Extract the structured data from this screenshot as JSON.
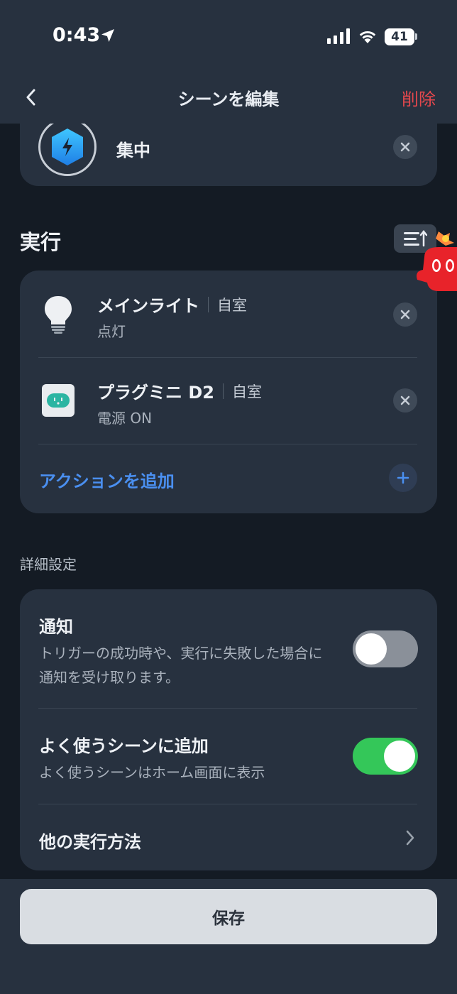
{
  "status": {
    "time": "0:43",
    "battery": "41"
  },
  "nav": {
    "title": "シーンを編集",
    "delete": "削除"
  },
  "scene": {
    "name": "集中"
  },
  "execution": {
    "title": "実行",
    "items": [
      {
        "name": "メインライト",
        "room": "自室",
        "state": "点灯"
      },
      {
        "name": "プラグミニ D2",
        "room": "自室",
        "state": "電源 ON"
      }
    ],
    "add_action": "アクションを追加"
  },
  "details": {
    "title": "詳細設定",
    "notify": {
      "title": "通知",
      "desc_line1": "トリガーの成功時や、実行に失敗した場合に",
      "desc_line2": "通知を受け取ります。",
      "enabled": false
    },
    "favorite": {
      "title": "よく使うシーンに追加",
      "desc": "よく使うシーンはホーム画面に表示",
      "enabled": true
    },
    "other": {
      "title": "他の実行方法"
    }
  },
  "save": "保存",
  "colors": {
    "accent": "#4a8ff0",
    "danger": "#e5484d",
    "toggle_on": "#34c759",
    "toggle_off": "#8a9099"
  }
}
